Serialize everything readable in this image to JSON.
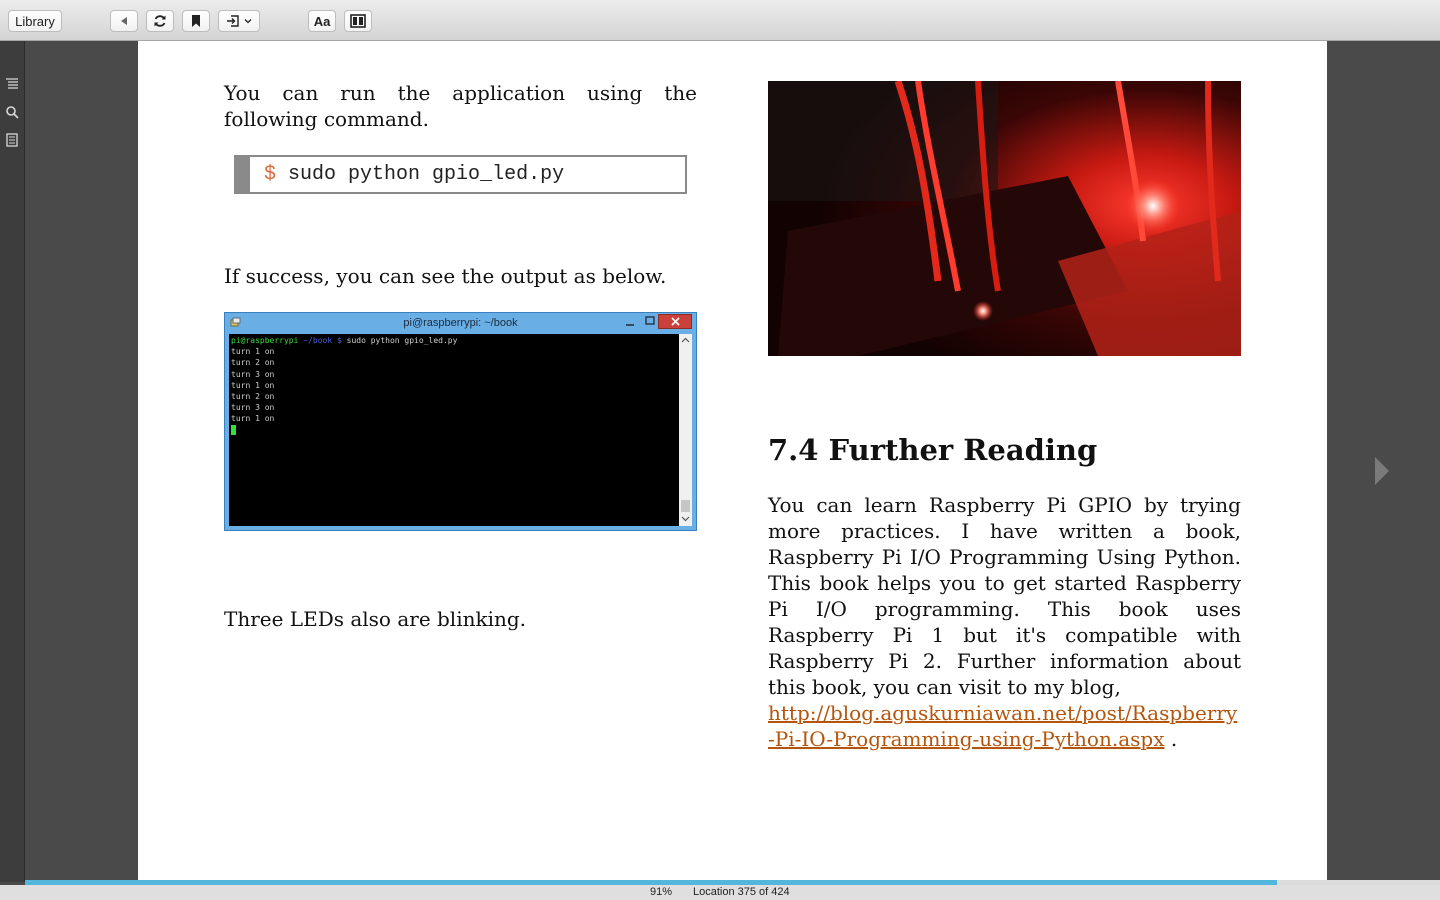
{
  "toolbar": {
    "library_label": "Library",
    "font_button_label": "Aa",
    "icons": [
      "back-icon",
      "sync-icon",
      "bookmark-icon",
      "goto-icon",
      "chevron-down-icon",
      "layout-icon"
    ]
  },
  "sidebar": {
    "icons": [
      "table-of-contents-icon",
      "search-icon",
      "notes-icon"
    ]
  },
  "book": {
    "left": {
      "para1": "You can run the application using the following command.",
      "command_prompt": "$",
      "command": "sudo python gpio_led.py",
      "para2": "If success, you can see the output as below.",
      "para3": "Three LEDs also are blinking."
    },
    "terminal": {
      "title": "pi@raspberrypi: ~/book",
      "prompt_user": "pi@raspberrypi",
      "prompt_path": "~/book $",
      "prompt_cmd": "sudo python gpio_led.py",
      "lines": [
        "turn 1 on",
        "turn 2 on",
        "turn 3 on",
        "turn 1 on",
        "turn 2 on",
        "turn 3 on",
        "turn 1 on"
      ]
    },
    "right": {
      "heading": "7.4 Further Reading",
      "paragraph": "You can learn Raspberry Pi GPIO by trying more practices. I have written a book, Raspberry Pi I/O Programming Using Python. This book helps you to get started Raspberry Pi I/O programming. This book uses Raspberry Pi 1 but it's compatible with Raspberry Pi 2. Further information about this book, you can visit to my blog,",
      "link_line1": "http://blog.aguskurniawan.net/post/Raspberry",
      "link_line2": "-Pi-IO-Programming-using-Python.aspx",
      "link_suffix": " ."
    }
  },
  "status": {
    "percent": "91%",
    "progress_fraction": 0.885,
    "location": "Location 375 of 424"
  },
  "colors": {
    "link": "#b5550c",
    "progress": "#53b7dd",
    "command_prompt": "#d96a3b"
  }
}
